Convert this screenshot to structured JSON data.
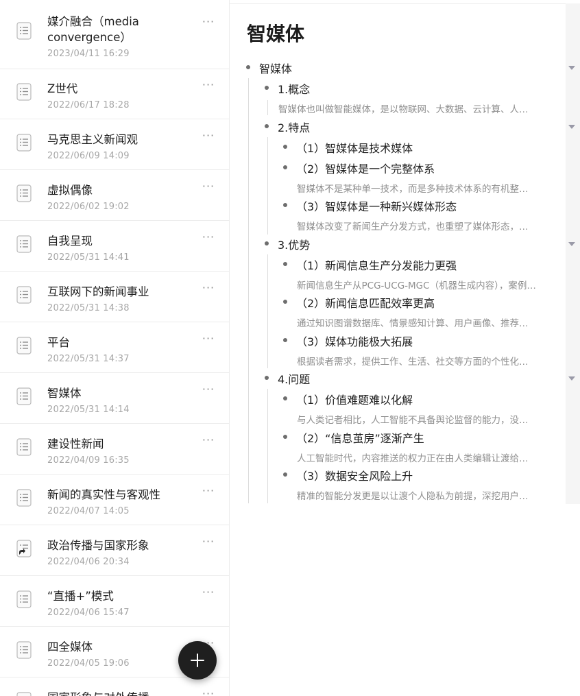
{
  "sidebar": {
    "documents": [
      {
        "title": "媒介融合（media convergence）",
        "date": "2023/04/11 16:29",
        "icon": "document-icon"
      },
      {
        "title": "Z世代",
        "date": "2022/06/17 18:28",
        "icon": "document-icon"
      },
      {
        "title": "马克思主义新闻观",
        "date": "2022/06/09 14:09",
        "icon": "document-icon"
      },
      {
        "title": "虚拟偶像",
        "date": "2022/06/02 19:02",
        "icon": "document-icon"
      },
      {
        "title": "自我呈现",
        "date": "2022/05/31 14:41",
        "icon": "document-icon"
      },
      {
        "title": "互联网下的新闻事业",
        "date": "2022/05/31 14:38",
        "icon": "document-icon"
      },
      {
        "title": "平台",
        "date": "2022/05/31 14:37",
        "icon": "document-icon"
      },
      {
        "title": "智媒体",
        "date": "2022/05/31 14:14",
        "icon": "document-icon"
      },
      {
        "title": "建设性新闻",
        "date": "2022/04/09 16:35",
        "icon": "document-icon"
      },
      {
        "title": "新闻的真实性与客观性",
        "date": "2022/04/07 14:05",
        "icon": "document-icon"
      },
      {
        "title": "政治传播与国家形象",
        "date": "2022/04/06 20:34",
        "icon": "shared-document-icon"
      },
      {
        "title": "“直播+”模式",
        "date": "2022/04/06 15:47",
        "icon": "document-icon"
      },
      {
        "title": "四全媒体",
        "date": "2022/04/05 19:06",
        "icon": "document-icon"
      },
      {
        "title": "国家形象与对外传播",
        "date": "",
        "icon": "document-icon"
      }
    ],
    "more_label": "···",
    "fab_icon": "plus-icon"
  },
  "outline": {
    "title": "智媒体",
    "root": "智媒体",
    "concept": {
      "heading": "1.概念",
      "note": "智媒体也叫做智能媒体，是以物联网、大数据、云计算、人…"
    },
    "features": {
      "heading": "2.特点",
      "items": [
        {
          "label": "（1）智媒体是技术媒体",
          "note": ""
        },
        {
          "label": "（2）智媒体是一个完整体系",
          "note": "智媒体不是某种单一技术，而是多种技术体系的有机整…"
        },
        {
          "label": "（3）智媒体是一种新兴媒体形态",
          "note": "智媒体改变了新闻生产分发方式，也重塑了媒体形态，…"
        }
      ]
    },
    "advantages": {
      "heading": "3.优势",
      "items": [
        {
          "label": "（1）新闻信息生产分发能力更强",
          "note": "新闻信息生产从PCG-UCG-MGC（机器生成内容），案例…"
        },
        {
          "label": "（2）新闻信息匹配效率更高",
          "note": "通过知识图谱数据库、情景感知计算、用户画像、推荐…"
        },
        {
          "label": "（3）媒体功能极大拓展",
          "note": "根据读者需求，提供工作、生活、社交等方面的个性化…"
        }
      ]
    },
    "problems": {
      "heading": "4.问题",
      "items": [
        {
          "label": "（1）价值难题难以化解",
          "note": "与人类记者相比，人工智能不具备舆论监督的能力，没…"
        },
        {
          "label": "（2）“信息茧房”逐渐产生",
          "note": "人工智能时代，内容推送的权力正在由人类编辑让渡给…"
        },
        {
          "label": "（3）数据安全风险上升",
          "note": "精准的智能分发更是以让渡个人隐私为前提，深挖用户…"
        }
      ]
    }
  }
}
